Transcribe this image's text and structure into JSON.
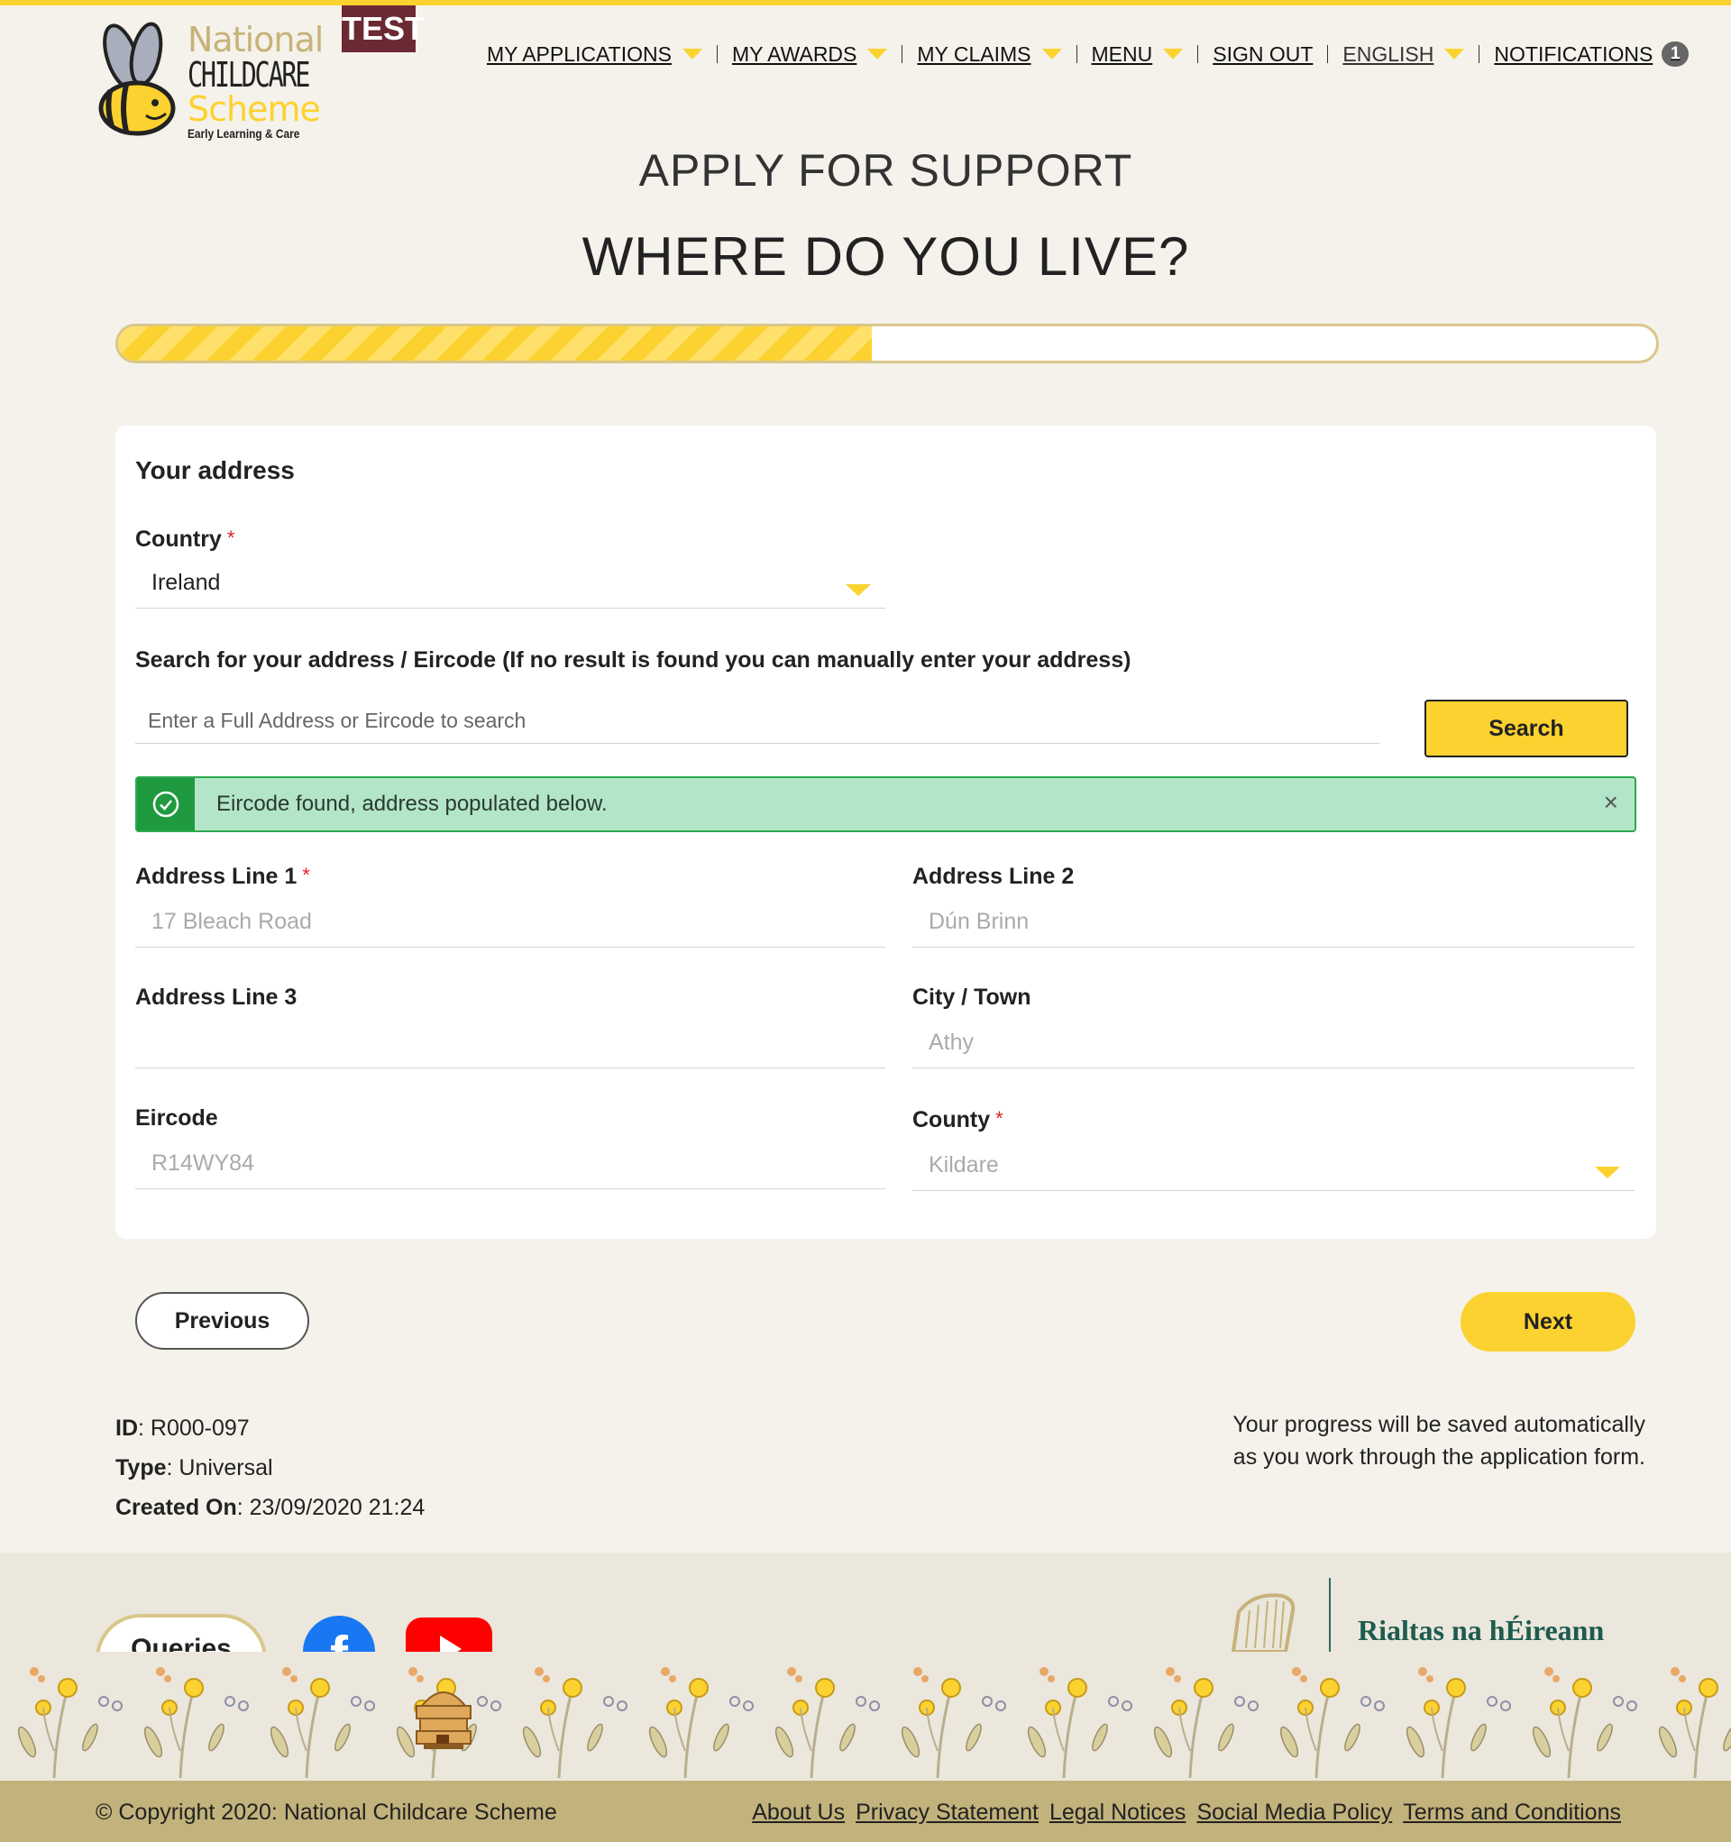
{
  "header": {
    "logo": {
      "national": "National",
      "childcare": "CHILDCARE",
      "scheme": "Scheme",
      "tagline": "Early Learning & Care"
    },
    "env_badge": "TEST",
    "nav": [
      {
        "label": "MY APPLICATIONS",
        "has_dropdown": true
      },
      {
        "label": "MY AWARDS",
        "has_dropdown": true
      },
      {
        "label": "MY CLAIMS",
        "has_dropdown": true
      },
      {
        "label": "MENU",
        "has_dropdown": true
      },
      {
        "label": "SIGN OUT",
        "has_dropdown": false
      },
      {
        "label": "ENGLISH",
        "has_dropdown": true
      },
      {
        "label": "NOTIFICATIONS",
        "has_dropdown": false,
        "count": "1"
      }
    ]
  },
  "page": {
    "title": "APPLY FOR SUPPORT",
    "subtitle": "WHERE DO YOU LIVE?",
    "progress_fraction": 0.49
  },
  "form": {
    "section_title": "Your address",
    "country": {
      "label": "Country",
      "required": "*",
      "value": "Ireland"
    },
    "search": {
      "label": "Search for your address / Eircode (If no result is found you can manually enter your address)",
      "placeholder": "Enter a Full Address or Eircode to search",
      "button_label": "Search"
    },
    "alert": {
      "message": "Eircode found, address populated below.",
      "close": "×"
    },
    "address_line_1": {
      "label": "Address Line 1",
      "required": "*",
      "value": "17 Bleach Road"
    },
    "address_line_2": {
      "label": "Address Line 2",
      "value": "Dún Brinn"
    },
    "address_line_3": {
      "label": "Address Line 3",
      "value": ""
    },
    "city_town": {
      "label": "City / Town",
      "value": "Athy"
    },
    "eircode": {
      "label": "Eircode",
      "value": "R14WY84"
    },
    "county": {
      "label": "County",
      "required": "*",
      "value": "Kildare"
    }
  },
  "actions": {
    "previous": "Previous",
    "next": "Next"
  },
  "meta": {
    "id_label": "ID",
    "id_value": ": R000-097",
    "type_label": "Type",
    "type_value": ": Universal",
    "created_label": "Created On",
    "created_value": ": 23/09/2020 21:24",
    "save_note_line1": "Your progress will be saved automatically",
    "save_note_line2": "as you work through the application form."
  },
  "footer": {
    "queries": "Queries",
    "gov_name": "Rialtas na hÉireann",
    "copyright": "© Copyright 2020: National Childcare Scheme",
    "links": [
      "About Us",
      "Privacy Statement",
      "Legal Notices",
      "Social Media Policy",
      "Terms and Conditions"
    ]
  },
  "colors": {
    "accent_yellow": "#fcd230",
    "success_green": "#1f9a3e",
    "success_bg": "#b3e5c8",
    "footer_band": "#c2b27b",
    "page_bg": "#f4f2ea"
  },
  "icons": [
    "bee-logo-icon",
    "dropdown-caret-icon",
    "check-circle-icon",
    "close-icon",
    "facebook-icon",
    "youtube-icon",
    "harp-icon",
    "beehive-icon"
  ]
}
